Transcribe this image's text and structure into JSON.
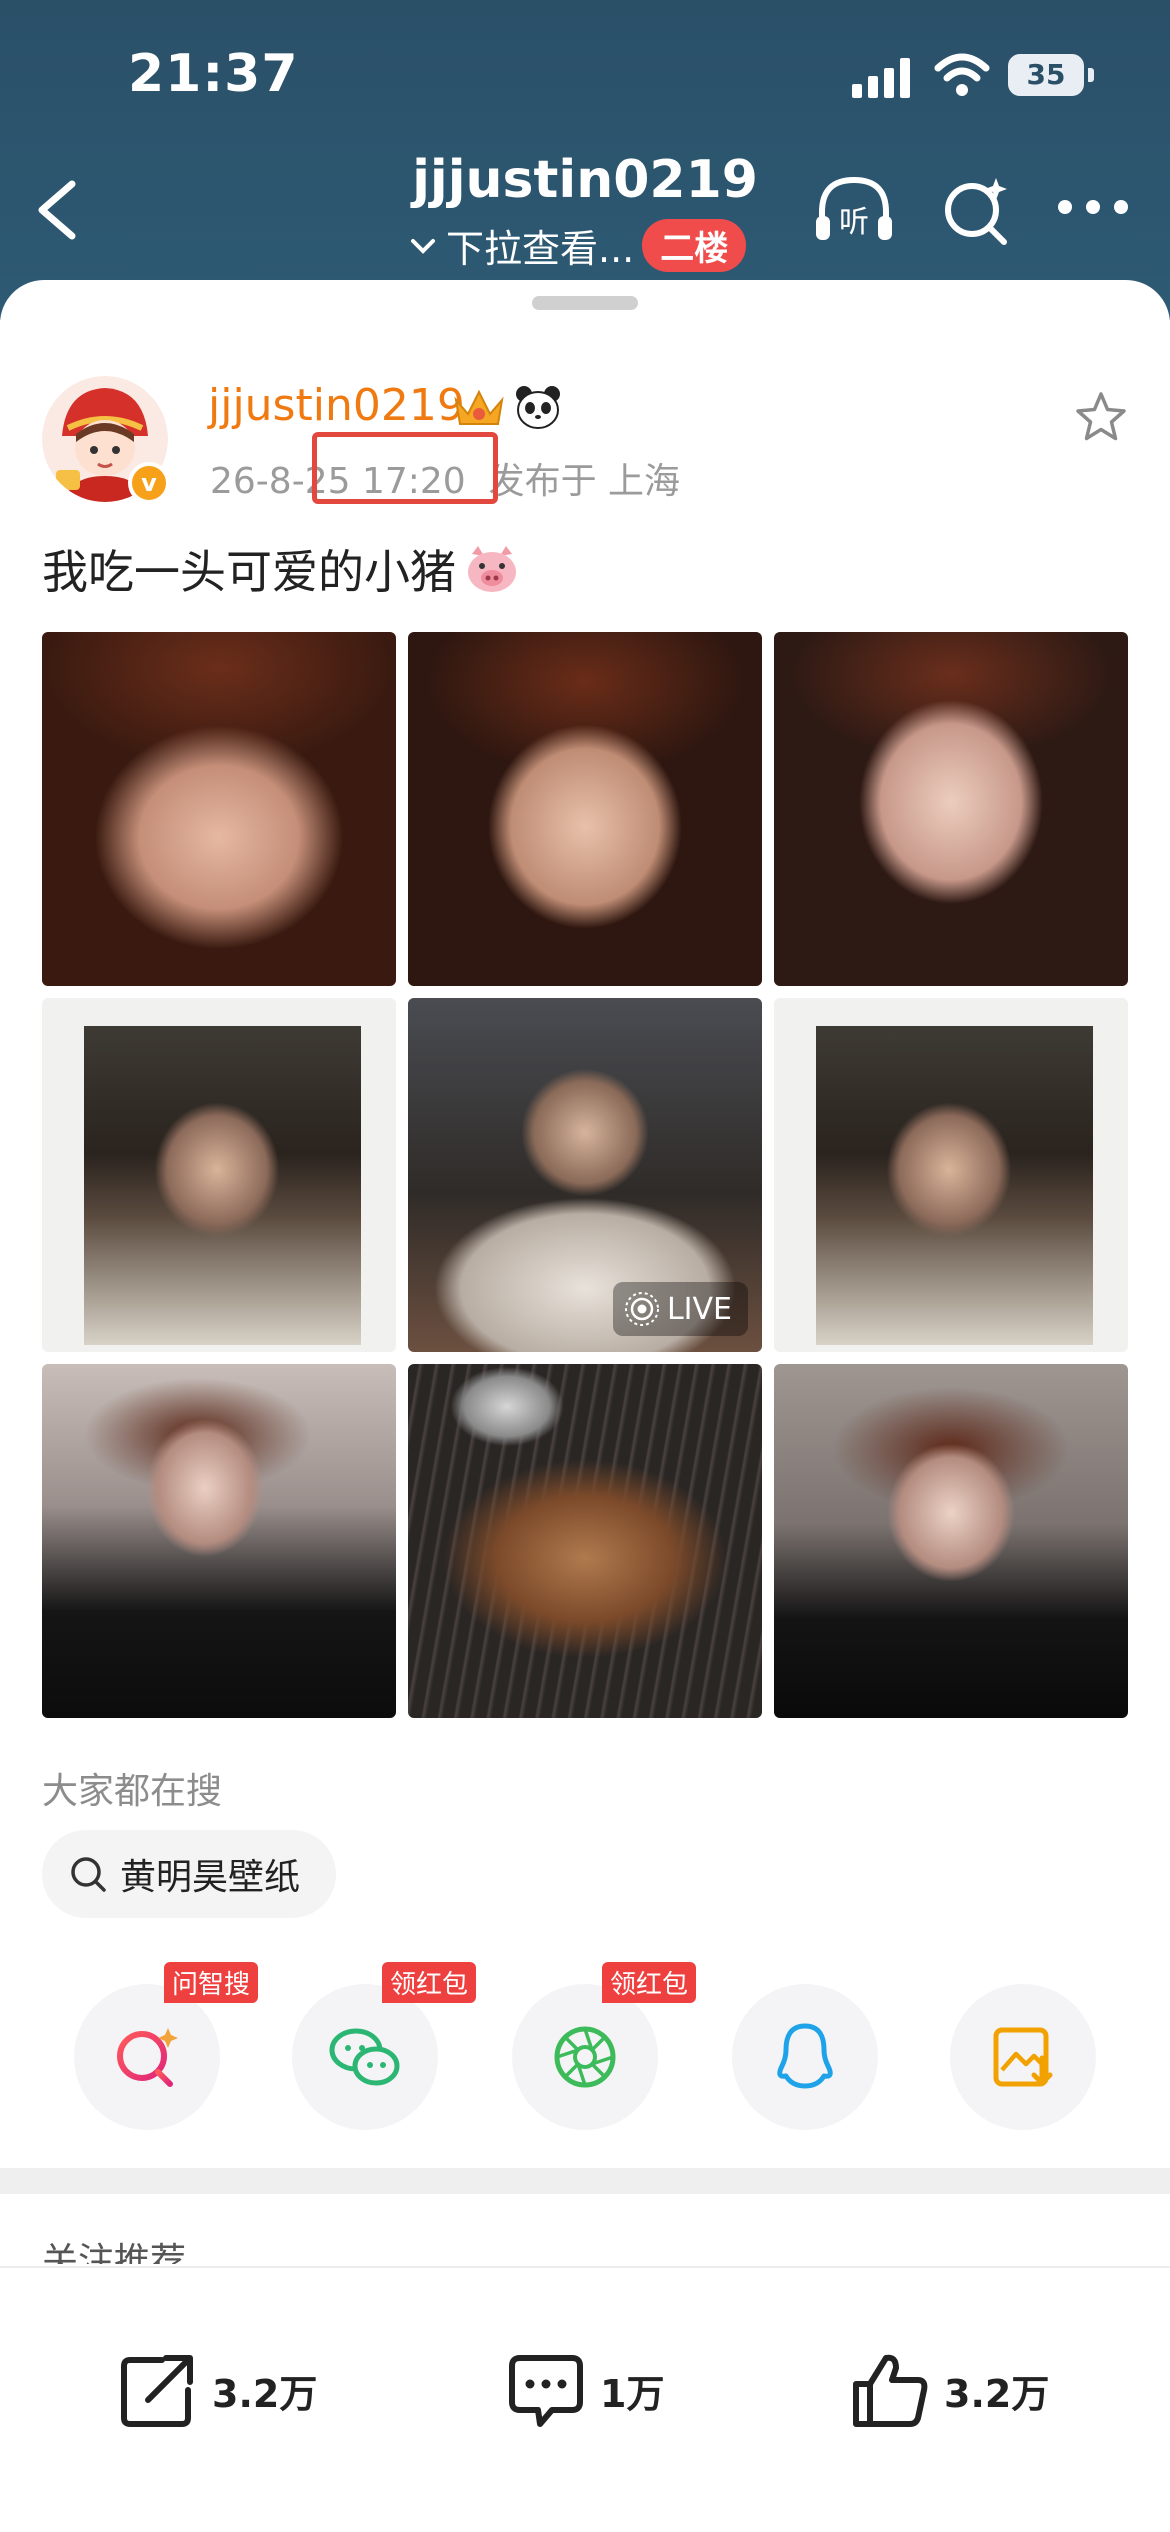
{
  "status_bar": {
    "time": "21:37",
    "battery": "35"
  },
  "nav": {
    "title": "jjjustin0219",
    "subtitle": "下拉查看...",
    "badge": "二楼",
    "listen_label": "听"
  },
  "post": {
    "username": "jjjustin0219",
    "verified_mark": "v",
    "meta": "26-8-25 17:20  发布于 上海",
    "text": "我吃一头可爱的小猪",
    "live_label": "LIVE",
    "photos": [
      "face-closeup-1",
      "face-closeup-2",
      "face-closeup-3",
      "polaroid-glasses-1",
      "cafe-glasses-live",
      "polaroid-glasses-2",
      "black-shirt-pose",
      "bbq-grill",
      "black-shirt-face"
    ]
  },
  "search": {
    "title": "大家都在搜",
    "chip": "黄明昊壁纸"
  },
  "share": [
    {
      "name": "ai-search",
      "tag": "问智搜"
    },
    {
      "name": "wechat",
      "tag": "领红包"
    },
    {
      "name": "moments",
      "tag": "领红包"
    },
    {
      "name": "qq",
      "tag": ""
    },
    {
      "name": "save-image",
      "tag": ""
    }
  ],
  "section": {
    "follow_recommend": "关注推荐"
  },
  "actions": {
    "share_count": "3.2万",
    "comment_count": "1万",
    "like_count": "3.2万"
  },
  "colors": {
    "header": "#2a5068",
    "username": "#f07a12",
    "badge_red": "#f04c4c",
    "highlight": "#e3483f"
  }
}
